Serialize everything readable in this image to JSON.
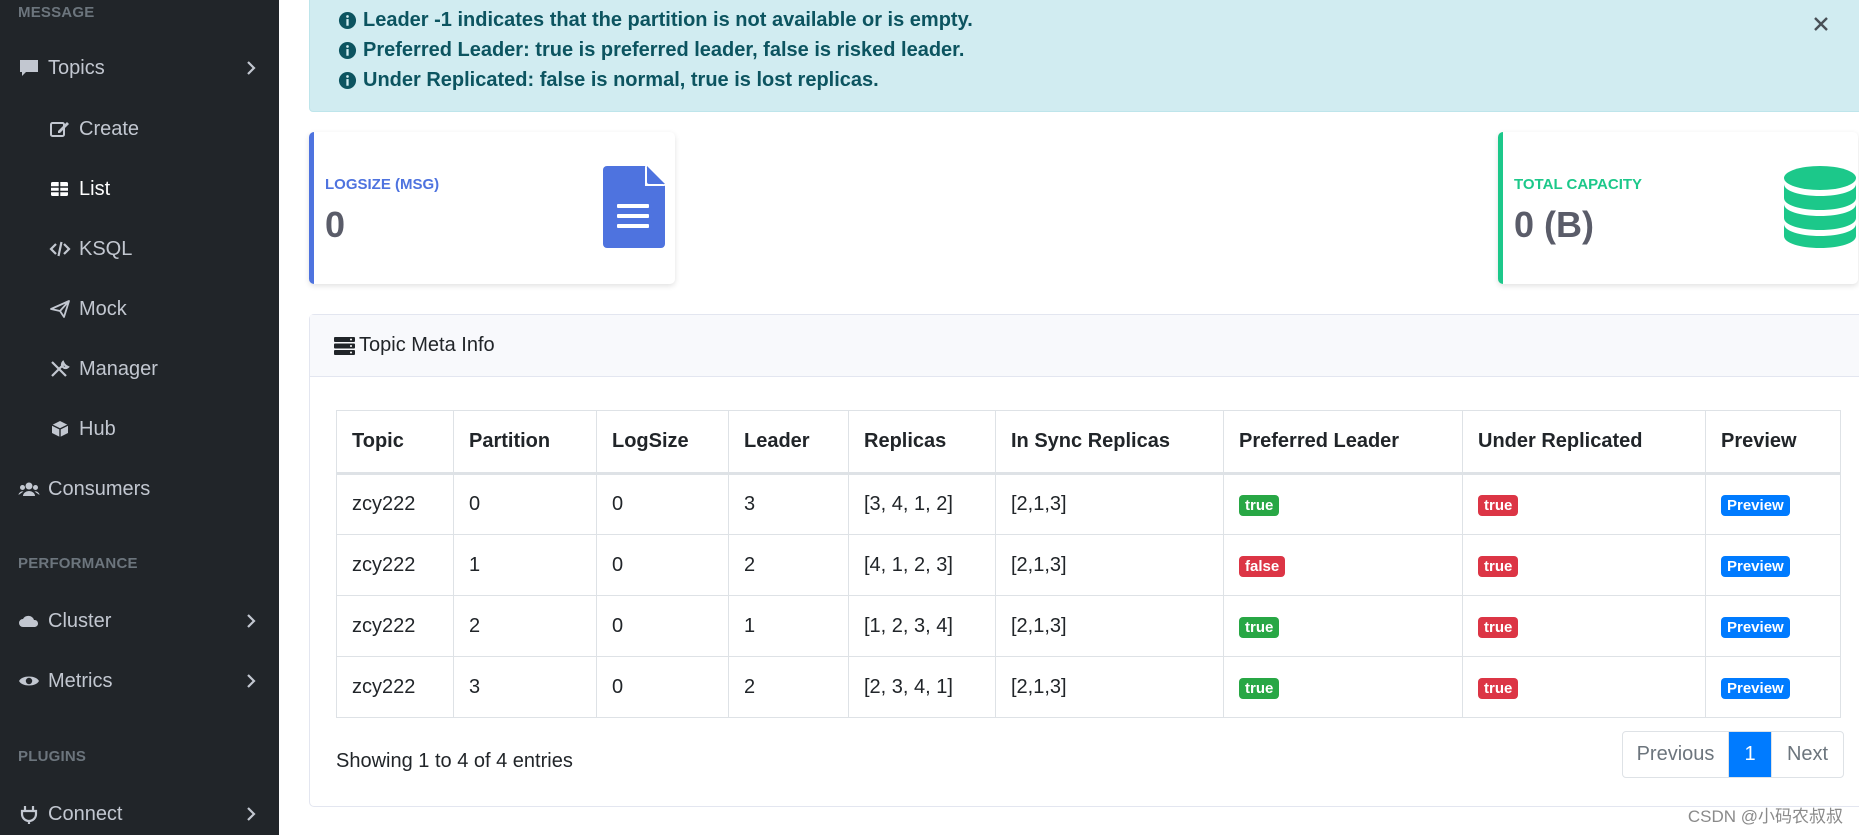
{
  "sidebar": {
    "headings": {
      "message": "MESSAGE",
      "performance": "PERFORMANCE",
      "plugins": "PLUGINS"
    },
    "items": {
      "topics": "Topics",
      "create": "Create",
      "list": "List",
      "ksql": "KSQL",
      "mock": "Mock",
      "manager": "Manager",
      "hub": "Hub",
      "consumers": "Consumers",
      "cluster": "Cluster",
      "metrics": "Metrics",
      "connect": "Connect"
    }
  },
  "alert": {
    "lines": [
      "Leader -1 indicates that the partition is not available or is empty.",
      "Preferred Leader: true is preferred leader, false is risked leader.",
      "Under Replicated: false is normal, true is lost replicas."
    ]
  },
  "stats": {
    "logsize": {
      "label": "LOGSIZE (MSG)",
      "value": "0",
      "color": "#4e73df"
    },
    "capacity": {
      "label": "TOTAL CAPACITY",
      "value": "0 (B)",
      "color": "#1cc88a"
    }
  },
  "panel": {
    "title": "Topic Meta Info",
    "columns": [
      "Topic",
      "Partition",
      "LogSize",
      "Leader",
      "Replicas",
      "In Sync Replicas",
      "Preferred Leader",
      "Under Replicated",
      "Preview"
    ],
    "rows": [
      {
        "topic": "zcy222",
        "partition": "0",
        "logsize": "0",
        "leader": "3",
        "replicas": "[3, 4, 1, 2]",
        "isr": "[2,1,3]",
        "preferred": "true",
        "under": "true",
        "preview": "Preview"
      },
      {
        "topic": "zcy222",
        "partition": "1",
        "logsize": "0",
        "leader": "2",
        "replicas": "[4, 1, 2, 3]",
        "isr": "[2,1,3]",
        "preferred": "false",
        "under": "true",
        "preview": "Preview"
      },
      {
        "topic": "zcy222",
        "partition": "2",
        "logsize": "0",
        "leader": "1",
        "replicas": "[1, 2, 3, 4]",
        "isr": "[2,1,3]",
        "preferred": "true",
        "under": "true",
        "preview": "Preview"
      },
      {
        "topic": "zcy222",
        "partition": "3",
        "logsize": "0",
        "leader": "2",
        "replicas": "[2, 3, 4, 1]",
        "isr": "[2,1,3]",
        "preferred": "true",
        "under": "true",
        "preview": "Preview"
      }
    ],
    "entries_text": "Showing 1 to 4 of 4 entries",
    "pagination": {
      "previous": "Previous",
      "page": "1",
      "next": "Next"
    }
  },
  "watermark": "CSDN @小码农叔叔",
  "colors": {
    "sidebar_bg": "#212529",
    "alert_bg": "#d1ecf1",
    "success": "#28a745",
    "danger": "#dc3545",
    "primary": "#007bff"
  }
}
